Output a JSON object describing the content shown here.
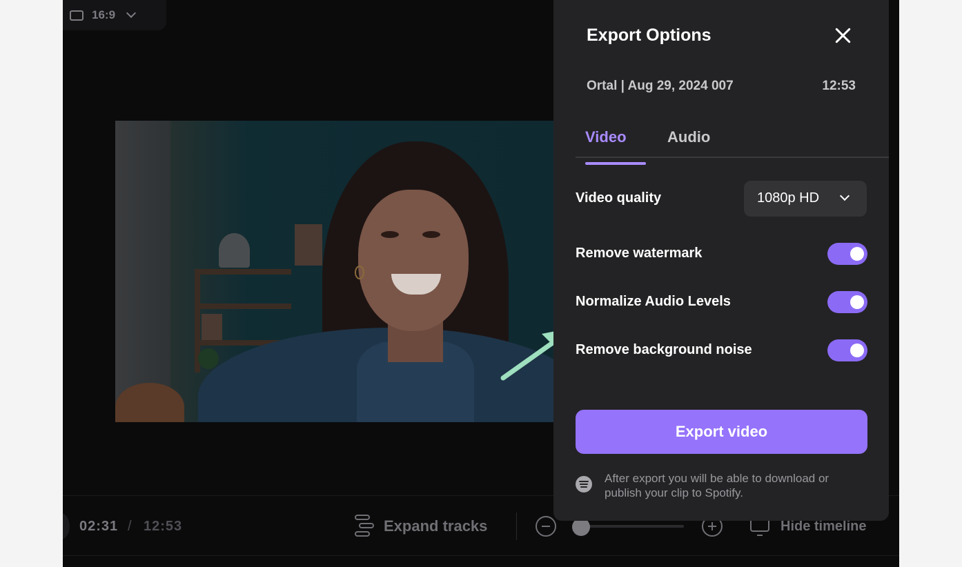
{
  "toolbar": {
    "aspect_ratio": "16:9"
  },
  "timeline": {
    "current_time": "02:31",
    "separator": "/",
    "total_time": "12:53",
    "expand_label": "Expand tracks",
    "hide_label": "Hide timeline"
  },
  "export_panel": {
    "title": "Export Options",
    "project_name": "Ortal | Aug 29, 2024 007",
    "duration": "12:53",
    "tabs": [
      {
        "label": "Video",
        "active": true
      },
      {
        "label": "Audio",
        "active": false
      }
    ],
    "video_quality_label": "Video quality",
    "video_quality_value": "1080p HD",
    "toggles": [
      {
        "label": "Remove watermark",
        "on": true
      },
      {
        "label": "Normalize Audio Levels",
        "on": true
      },
      {
        "label": "Remove background noise",
        "on": true
      }
    ],
    "export_button": "Export video",
    "note": "After export you will be able to download or publish your clip to Spotify."
  },
  "colors": {
    "accent": "#9573fb",
    "tab_active": "#a98bff",
    "panel_bg": "#232325",
    "annotation_arrow": "#9ee0bf"
  }
}
